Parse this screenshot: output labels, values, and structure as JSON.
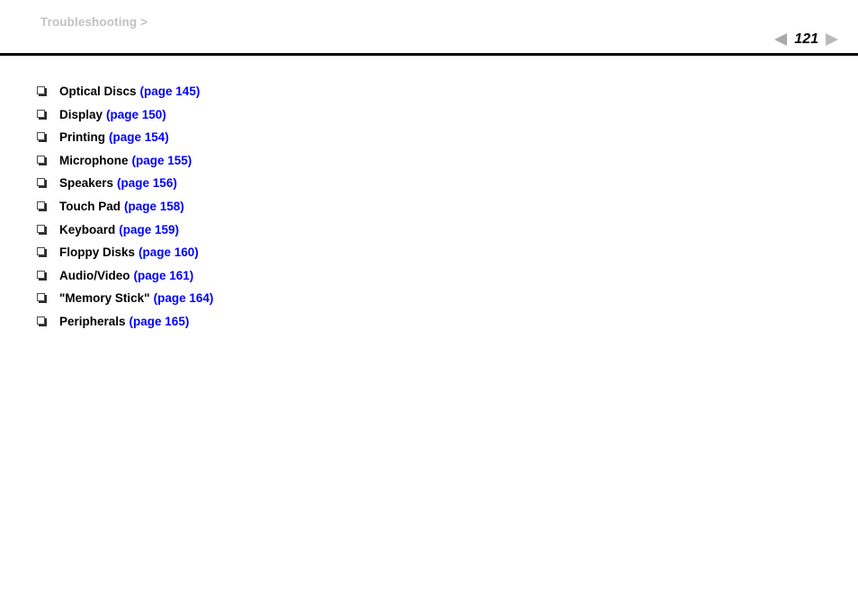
{
  "header": {
    "breadcrumb_label": "Troubleshooting",
    "breadcrumb_separator": ">",
    "pager": {
      "page_number": "121",
      "prev_icon": "triangle-left-icon",
      "next_icon": "triangle-right-icon",
      "prev_color": "#a9a9a9",
      "next_color": "#b9b9b9"
    },
    "rule_color": "#000000",
    "breadcrumb_color": "#c2c2c2"
  },
  "colors": {
    "background": "#ffffff",
    "text": "#000000",
    "link": "#0000ff",
    "muted": "#c2c2c2"
  },
  "content": {
    "bullet_icon": "square-bullet-icon",
    "items": [
      {
        "label": "Optical Discs",
        "link": "(page 145)"
      },
      {
        "label": "Display",
        "link": "(page 150)"
      },
      {
        "label": "Printing",
        "link": "(page 154)"
      },
      {
        "label": "Microphone",
        "link": "(page 155)"
      },
      {
        "label": "Speakers",
        "link": "(page 156)"
      },
      {
        "label": "Touch Pad",
        "link": "(page 158)"
      },
      {
        "label": "Keyboard",
        "link": "(page 159)"
      },
      {
        "label": "Floppy Disks",
        "link": "(page 160)"
      },
      {
        "label": "Audio/Video",
        "link": "(page 161)"
      },
      {
        "label": "\"Memory Stick\"",
        "link": "(page 164)"
      },
      {
        "label": "Peripherals",
        "link": "(page 165)"
      }
    ]
  }
}
